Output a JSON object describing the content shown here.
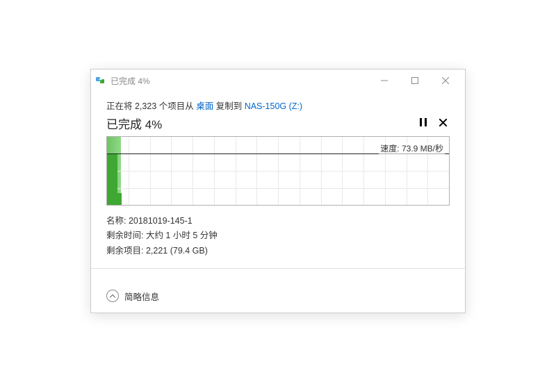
{
  "titlebar": {
    "title": "已完成 4%"
  },
  "copy": {
    "prefix": "正在将 ",
    "count": "2,323",
    "mid1": " 个项目从 ",
    "source": "桌面",
    "mid2": " 复制到 ",
    "destination": "NAS-150G (Z:)"
  },
  "progress": {
    "label": "已完成 4%"
  },
  "chart_data": {
    "type": "area",
    "title": "",
    "xlabel": "",
    "ylabel": "",
    "ylim": [
      0,
      100
    ],
    "x": [
      0,
      1,
      2,
      3
    ],
    "values": [
      76,
      76,
      76,
      76
    ],
    "progress_pct": 4,
    "midline_value": 73.9,
    "speed_label_prefix": "速度: ",
    "speed_value": "73.9 MB/秒"
  },
  "info": {
    "name_label": "名称: ",
    "name_value": "20181019-145-1",
    "time_label": "剩余时间: ",
    "time_value": "大约 1 小时 5 分钟",
    "items_label": "剩余项目: ",
    "items_value": "2,221 (79.4 GB)"
  },
  "footer": {
    "toggle_label": "简略信息"
  }
}
